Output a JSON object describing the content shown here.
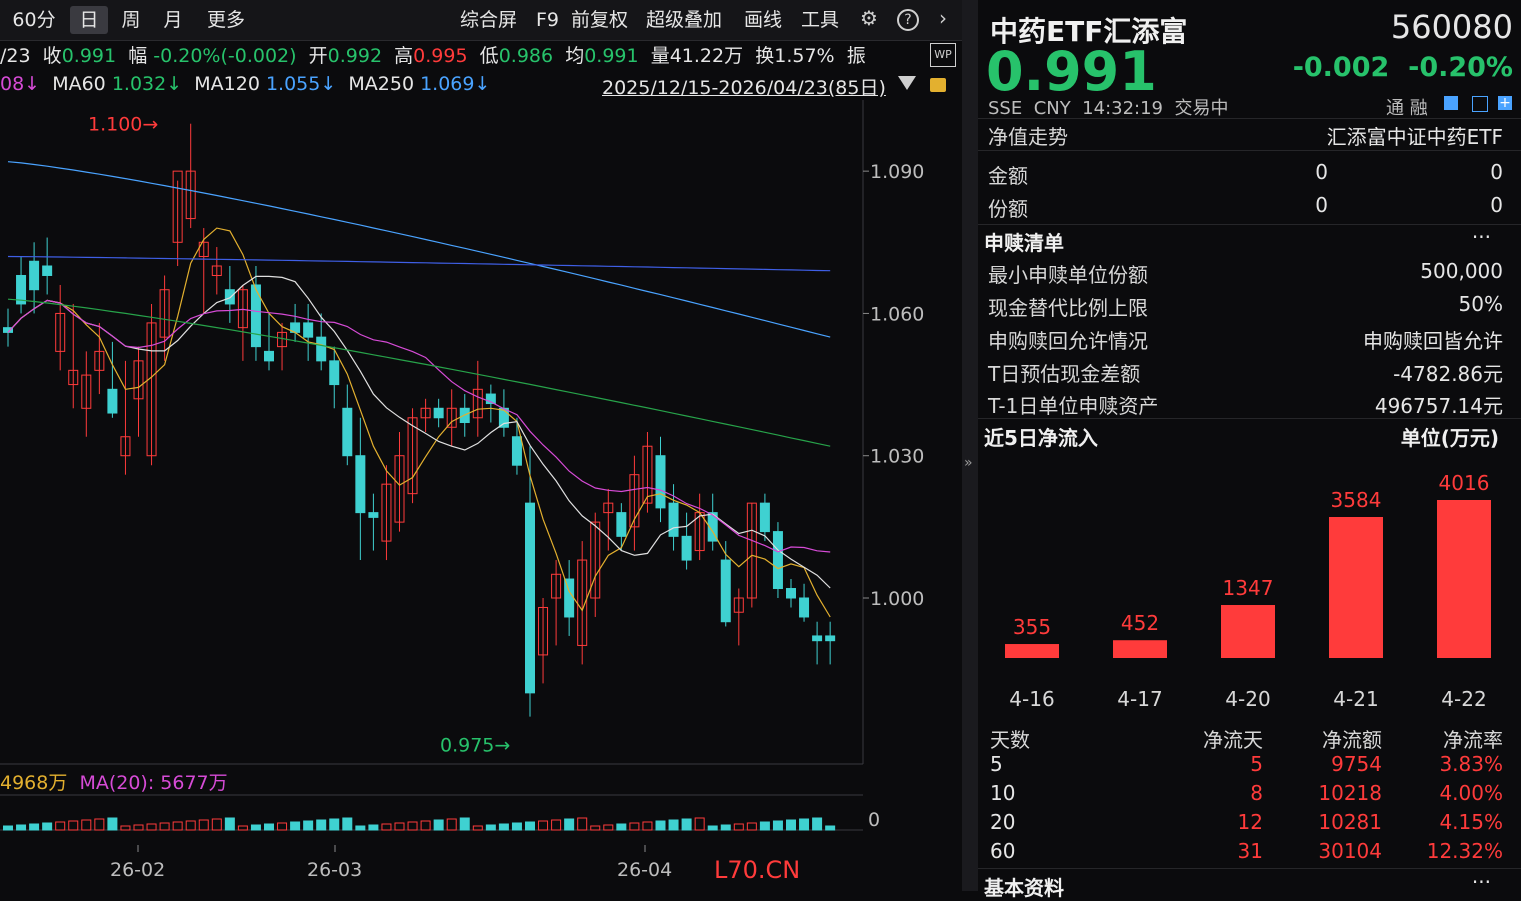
{
  "toolbar": {
    "tabs": [
      "60分",
      "日",
      "周",
      "月",
      "更多"
    ],
    "active_tab": "日",
    "tools": [
      "综合屏",
      "F9",
      "前复权",
      "超级叠加",
      "画线",
      "工具"
    ],
    "icons": [
      "gear-icon",
      "help-icon",
      "chevron-right-icon"
    ]
  },
  "quote_bar": {
    "date_fragment": "/23",
    "close_label": "收",
    "close": "0.991",
    "change_label": "幅",
    "change": "-0.20%(-0.002)",
    "open_label": "开",
    "open": "0.992",
    "high_label": "高",
    "high": "0.995",
    "low_label": "低",
    "low": "0.986",
    "avg_label": "均",
    "avg": "0.991",
    "vol_label": "量",
    "vol": "41.22万",
    "turnover_label": "换",
    "turnover": "1.57%",
    "amp_label": "振"
  },
  "ma_bar": {
    "ma_fragment": "08↓",
    "ma60_label": "MA60",
    "ma60": "1.032↓",
    "ma120_label": "MA120",
    "ma120": "1.055↓",
    "ma250_label": "MA250",
    "ma250": "1.069↓",
    "range": "2025/12/15-2026/04/23(85日)"
  },
  "chart": {
    "y_ticks": [
      "1.090",
      "1.060",
      "1.030",
      "1.000"
    ],
    "high_mark": "1.100",
    "low_mark": "0.975",
    "x_ticks": [
      "26-02",
      "26-03",
      "26-04"
    ],
    "watermark": "L70.CN",
    "vol_label": "4968万",
    "vol_ma_label": "MA(20): 5677万",
    "vol_zero": "0",
    "colors": {
      "up": "#ff3b3b",
      "down": "#3fd1d1",
      "ma5": "#e6e6e6",
      "ma10": "#e3b02f",
      "ma20": "#d64bd6",
      "ma60": "#27a34a",
      "ma120": "#4aa3ff",
      "ma250": "#3f5fe6"
    }
  },
  "chart_data": {
    "type": "candlestick",
    "ylim": [
      0.965,
      1.105
    ],
    "candles": [
      [
        1.057,
        1.061,
        1.053,
        1.056
      ],
      [
        1.068,
        1.072,
        1.06,
        1.062
      ],
      [
        1.071,
        1.075,
        1.06,
        1.065
      ],
      [
        1.07,
        1.076,
        1.064,
        1.068
      ],
      [
        1.052,
        1.066,
        1.048,
        1.06
      ],
      [
        1.045,
        1.062,
        1.04,
        1.048
      ],
      [
        1.04,
        1.052,
        1.034,
        1.047
      ],
      [
        1.048,
        1.058,
        1.043,
        1.052
      ],
      [
        1.044,
        1.054,
        1.038,
        1.039
      ],
      [
        1.03,
        1.05,
        1.026,
        1.034
      ],
      [
        1.042,
        1.053,
        1.034,
        1.05
      ],
      [
        1.03,
        1.062,
        1.028,
        1.058
      ],
      [
        1.055,
        1.068,
        1.05,
        1.065
      ],
      [
        1.075,
        1.088,
        1.07,
        1.09
      ],
      [
        1.08,
        1.1,
        1.078,
        1.09
      ],
      [
        1.072,
        1.078,
        1.06,
        1.075
      ],
      [
        1.068,
        1.074,
        1.064,
        1.07
      ],
      [
        1.065,
        1.07,
        1.058,
        1.062
      ],
      [
        1.057,
        1.066,
        1.05,
        1.065
      ],
      [
        1.066,
        1.07,
        1.05,
        1.053
      ],
      [
        1.052,
        1.06,
        1.048,
        1.05
      ],
      [
        1.053,
        1.058,
        1.048,
        1.056
      ],
      [
        1.058,
        1.062,
        1.054,
        1.056
      ],
      [
        1.058,
        1.062,
        1.05,
        1.055
      ],
      [
        1.055,
        1.06,
        1.048,
        1.05
      ],
      [
        1.05,
        1.053,
        1.04,
        1.045
      ],
      [
        1.04,
        1.045,
        1.028,
        1.03
      ],
      [
        1.03,
        1.038,
        1.008,
        1.018
      ],
      [
        1.018,
        1.022,
        1.01,
        1.017
      ],
      [
        1.012,
        1.028,
        1.008,
        1.024
      ],
      [
        1.016,
        1.035,
        1.014,
        1.03
      ],
      [
        1.022,
        1.04,
        1.02,
        1.038
      ],
      [
        1.038,
        1.042,
        1.035,
        1.04
      ],
      [
        1.04,
        1.042,
        1.036,
        1.038
      ],
      [
        1.036,
        1.044,
        1.032,
        1.04
      ],
      [
        1.04,
        1.043,
        1.034,
        1.037
      ],
      [
        1.038,
        1.05,
        1.034,
        1.044
      ],
      [
        1.043,
        1.045,
        1.037,
        1.041
      ],
      [
        1.04,
        1.044,
        1.034,
        1.036
      ],
      [
        1.034,
        1.038,
        1.026,
        1.028
      ],
      [
        1.02,
        1.032,
        0.975,
        0.98
      ],
      [
        0.988,
        1.0,
        0.982,
        0.998
      ],
      [
        1.0,
        1.008,
        0.99,
        1.005
      ],
      [
        1.004,
        1.008,
        0.992,
        0.996
      ],
      [
        0.99,
        1.012,
        0.986,
        1.008
      ],
      [
        1.0,
        1.018,
        0.996,
        1.016
      ],
      [
        1.018,
        1.023,
        1.01,
        1.02
      ],
      [
        1.018,
        1.02,
        1.01,
        1.013
      ],
      [
        1.015,
        1.03,
        1.01,
        1.026
      ],
      [
        1.02,
        1.035,
        1.018,
        1.032
      ],
      [
        1.03,
        1.034,
        1.016,
        1.019
      ],
      [
        1.02,
        1.024,
        1.01,
        1.013
      ],
      [
        1.013,
        1.018,
        1.006,
        1.008
      ],
      [
        1.01,
        1.022,
        1.008,
        1.018
      ],
      [
        1.018,
        1.022,
        1.01,
        1.012
      ],
      [
        1.008,
        1.012,
        0.994,
        0.995
      ],
      [
        0.997,
        1.002,
        0.99,
        1.0
      ],
      [
        1.0,
        1.02,
        0.998,
        1.02
      ],
      [
        1.02,
        1.022,
        1.012,
        1.014
      ],
      [
        1.014,
        1.016,
        1.0,
        1.002
      ],
      [
        1.002,
        1.004,
        0.998,
        1.0
      ],
      [
        1.0,
        1.003,
        0.995,
        0.996
      ],
      [
        0.992,
        0.995,
        0.986,
        0.991
      ],
      [
        0.992,
        0.995,
        0.986,
        0.991
      ]
    ]
  },
  "header": {
    "name": "中药ETF汇添富",
    "code": "560080",
    "price": "0.991",
    "change": "-0.002",
    "change_pct": "-0.20%",
    "market": "SSE",
    "currency": "CNY",
    "time": "14:32:19",
    "status": "交易中",
    "tags": "通 融"
  },
  "nav_section": {
    "title": "净值走势",
    "fund_name": "汇添富中证中药ETF",
    "rows": [
      {
        "label": "金额",
        "v1": "0",
        "v2": "0"
      },
      {
        "label": "份额",
        "v1": "0",
        "v2": "0"
      }
    ]
  },
  "redeem_section": {
    "title": "申赎清单",
    "more": "···",
    "rows": [
      {
        "label": "最小申赎单位份额",
        "value": "500,000"
      },
      {
        "label": "现金替代比例上限",
        "value": "50%"
      },
      {
        "label": "申购赎回允许情况",
        "value": "申购赎回皆允许"
      },
      {
        "label": "T日预估现金差额",
        "value": "-4782.86元"
      },
      {
        "label": "T-1日单位申赎资产",
        "value": "496757.14元"
      }
    ]
  },
  "flow_section": {
    "title": "近5日净流入",
    "unit": "单位(万元)",
    "bars": [
      {
        "date": "4-16",
        "value": 355
      },
      {
        "date": "4-17",
        "value": 452
      },
      {
        "date": "4-20",
        "value": 1347
      },
      {
        "date": "4-21",
        "value": 3584
      },
      {
        "date": "4-22",
        "value": 4016
      }
    ],
    "table_headers": [
      "天数",
      "净流天",
      "净流额",
      "净流率"
    ],
    "table_rows": [
      [
        "5",
        "5",
        "9754",
        "3.83%"
      ],
      [
        "10",
        "8",
        "10218",
        "4.00%"
      ],
      [
        "20",
        "12",
        "10281",
        "4.15%"
      ],
      [
        "60",
        "31",
        "30104",
        "12.32%"
      ]
    ],
    "footer_title": "基本资料"
  }
}
